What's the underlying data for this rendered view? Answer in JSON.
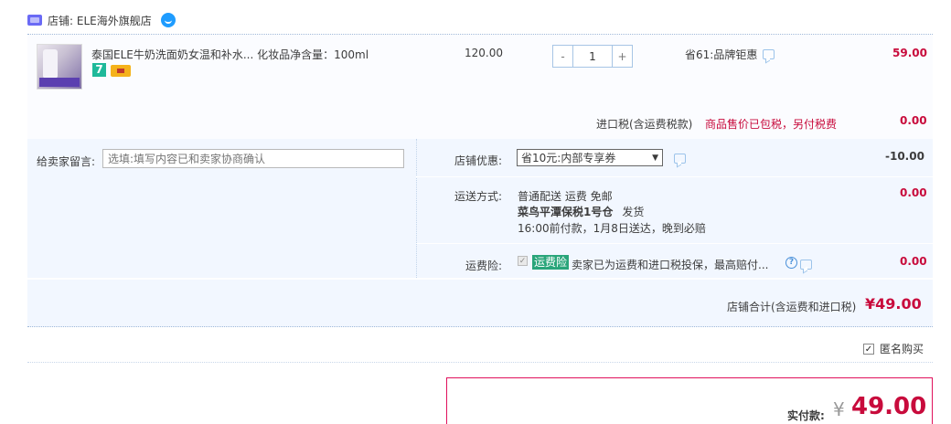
{
  "shop": {
    "label": "店铺: ELE海外旗舰店"
  },
  "item": {
    "title": "泰国ELE牛奶洗面奶女温和补水...    化妆品净含量：100ml",
    "badge_seven": "7",
    "unit_price": "120.00",
    "quantity": "1",
    "minus_label": "-",
    "plus_label": "+",
    "promo": "省61:品牌钜惠",
    "subtotal": "59.00"
  },
  "tax": {
    "label": "进口税(含运费税款)",
    "note": "商品售价已包税，另付税费",
    "value": "0.00"
  },
  "message": {
    "label": "给卖家留言:",
    "placeholder": "选填:填写内容已和卖家协商确认"
  },
  "coupon": {
    "label": "店铺优惠:",
    "selected": "省10元:内部专享券",
    "value": "-10.00"
  },
  "shipping": {
    "label": "运送方式:",
    "method": "普通配送 运费 免邮",
    "warehouse": "菜鸟平潭保税1号仓",
    "dispatch": "发货",
    "eta": "16:00前付款，1月8日送达，晚到必赔",
    "value": "0.00"
  },
  "insurance": {
    "label": "运费险:",
    "tag": "运费险",
    "text": "卖家已为运费和进口税投保，最高赔付...",
    "value": "0.00"
  },
  "shop_total": {
    "label": "店铺合计(含运费和进口税)",
    "value": "¥49.00"
  },
  "anonymous": {
    "label": "匿名购买"
  },
  "payment": {
    "label": "实付款:",
    "currency": "¥",
    "value": "49.00"
  },
  "colors": {
    "price_red": "#c80b3c",
    "border_blue": "#a7c5e5",
    "bg_blue": "#f2f7ff",
    "insurance_green": "#29a57a"
  }
}
